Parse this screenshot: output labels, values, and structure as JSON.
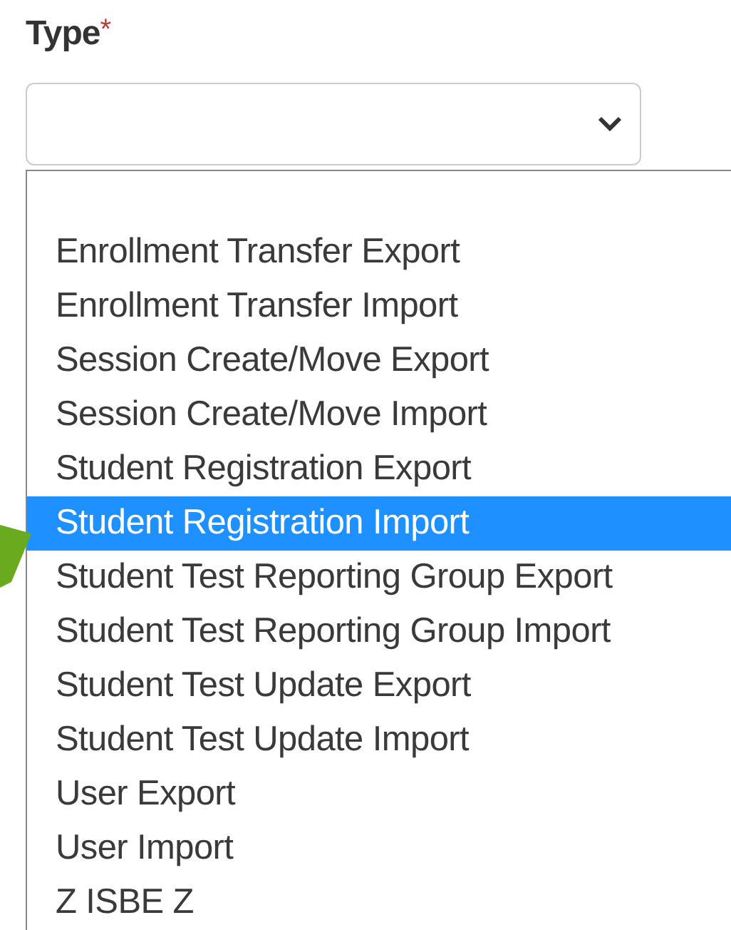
{
  "field": {
    "label": "Type",
    "required_mark": "*"
  },
  "options": [
    {
      "label": "Enrollment Transfer Export",
      "selected": false
    },
    {
      "label": "Enrollment Transfer Import",
      "selected": false
    },
    {
      "label": "Session Create/Move Export",
      "selected": false
    },
    {
      "label": "Session Create/Move Import",
      "selected": false
    },
    {
      "label": "Student Registration Export",
      "selected": false
    },
    {
      "label": "Student Registration Import",
      "selected": true
    },
    {
      "label": "Student Test Reporting Group Export",
      "selected": false
    },
    {
      "label": "Student Test Reporting Group Import",
      "selected": false
    },
    {
      "label": "Student Test Update Export",
      "selected": false
    },
    {
      "label": "Student Test Update Import",
      "selected": false
    },
    {
      "label": "User Export",
      "selected": false
    },
    {
      "label": "User Import",
      "selected": false
    },
    {
      "label": "Z ISBE Z",
      "selected": false
    }
  ]
}
